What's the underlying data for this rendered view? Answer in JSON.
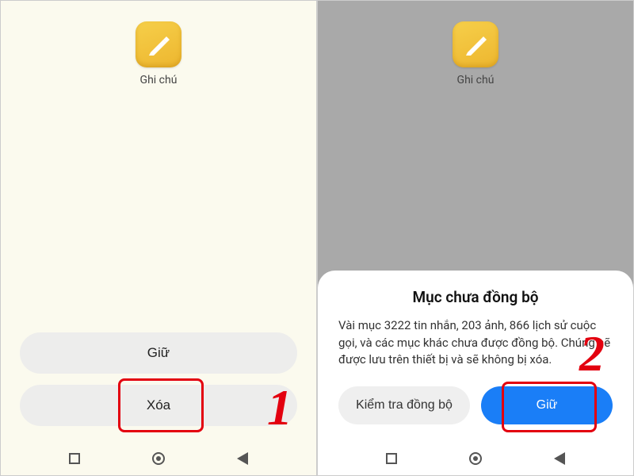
{
  "app": {
    "label": "Ghi chú",
    "icon_name": "notes-icon"
  },
  "left": {
    "keep_label": "Giữ",
    "delete_label": "Xóa"
  },
  "right": {
    "sheet_title": "Mục chưa đồng bộ",
    "sheet_body": "Vài mục 3222 tin nhắn, 203 ảnh, 866 lịch sử cuộc gọi, và các mục khác chưa được đồng bộ. Chúng sẽ được lưu trên thiết bị và sẽ không bị xóa.",
    "check_sync_label": "Kiểm tra đồng bộ",
    "keep_label": "Giữ"
  },
  "annotations": {
    "step1": "1",
    "step2": "2"
  }
}
